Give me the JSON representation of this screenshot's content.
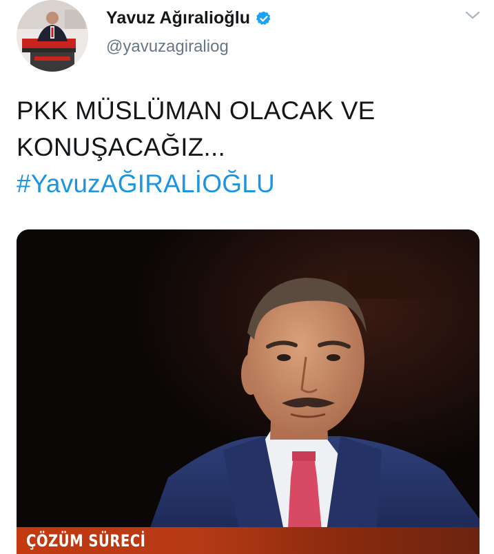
{
  "tweet": {
    "author": {
      "display_name": "Yavuz Ağıralioğlu",
      "handle": "@yavuzagiraliog",
      "verified": true,
      "avatar_icon": "avatar-photo"
    },
    "menu_icon": "chevron-down-icon",
    "text_lines": [
      "PKK MÜSLÜMAN OLACAK VE",
      "KONUŞACAĞIZ..."
    ],
    "hashtag": "#YavuzAĞIRALİOĞLU",
    "media": {
      "type": "tv-still",
      "lower_third_label": "ÇÖZÜM SÜRECİ"
    }
  },
  "colors": {
    "text": "#14171a",
    "secondary": "#657786",
    "link": "#1b95e0",
    "verified": "#1da1f2",
    "lower_third": "#c33a10"
  }
}
